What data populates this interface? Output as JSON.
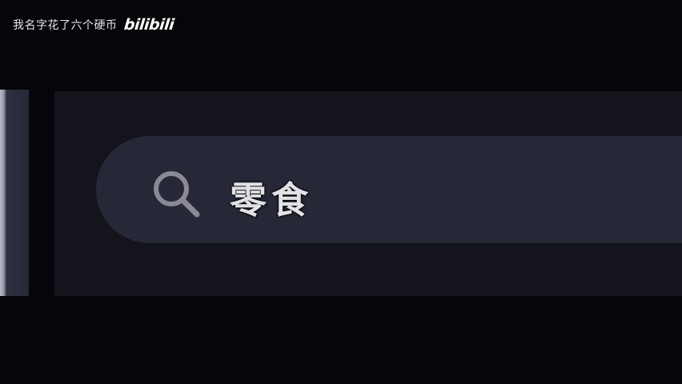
{
  "watermark": {
    "text": "我名字花了六个硬币",
    "logo": "bilibili"
  },
  "search": {
    "icon": "search-icon",
    "query": "零食"
  },
  "colors": {
    "background": "#05050a",
    "panel": "#13141c",
    "search_bar": "#262837",
    "icon": "#8a8a94",
    "text": "#e2e2e6"
  }
}
